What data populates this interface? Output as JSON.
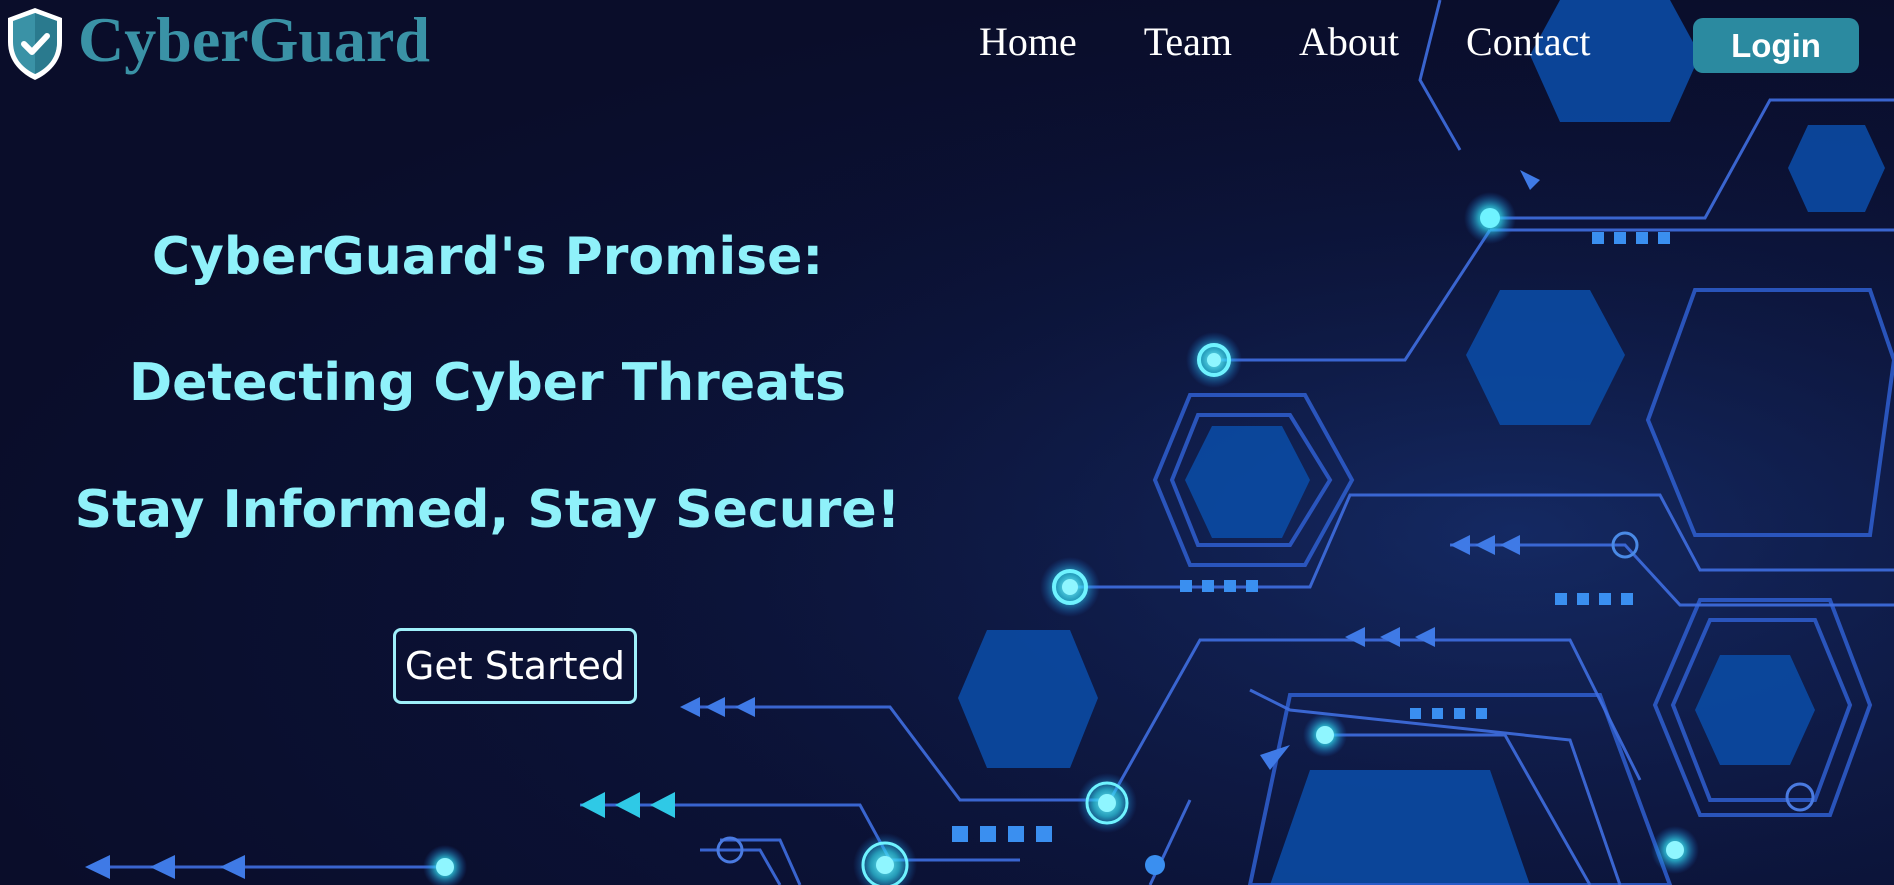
{
  "brand": {
    "name": "CyberGuard",
    "logo_icon": "shield-check-icon"
  },
  "nav": {
    "items": [
      {
        "label": "Home"
      },
      {
        "label": "Team"
      },
      {
        "label": "About"
      },
      {
        "label": "Contact"
      }
    ],
    "login_label": "Login"
  },
  "hero": {
    "line1": "CyberGuard's Promise:",
    "line2": "Detecting Cyber Threats",
    "line3": "Stay Informed, Stay Secure!",
    "cta_label": "Get Started"
  },
  "colors": {
    "background": "#0a0d2a",
    "brand": "#3a92a6",
    "hero_text": "#8ff1fa",
    "login_button": "#2b8aa0",
    "circuit_glow": "#3fe6f5",
    "hexagon": "#0a4aa0"
  }
}
